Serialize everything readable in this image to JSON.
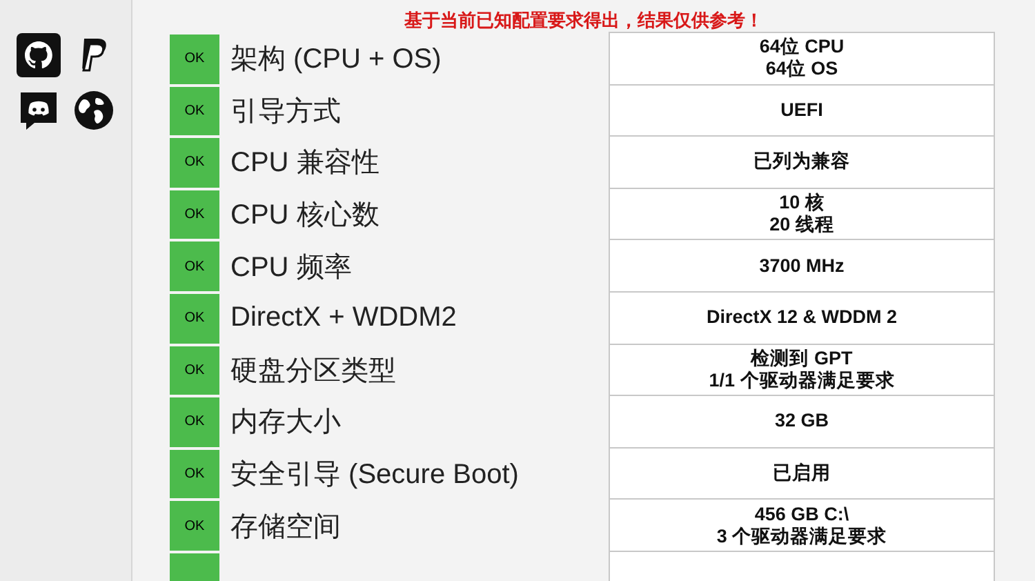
{
  "notice": "基于当前已知配置要求得出，结果仅供参考！",
  "sidebar": {
    "links": [
      {
        "kind": "github"
      },
      {
        "kind": "paypal"
      },
      {
        "kind": "discord"
      },
      {
        "kind": "globe"
      }
    ]
  },
  "checks": [
    {
      "status": "OK",
      "passed": true,
      "label": "架构 (CPU + OS)",
      "value": [
        "64位 CPU",
        "64位 OS"
      ]
    },
    {
      "status": "OK",
      "passed": true,
      "label": "引导方式",
      "value": [
        "UEFI"
      ]
    },
    {
      "status": "OK",
      "passed": true,
      "label": "CPU 兼容性",
      "value": [
        "已列为兼容"
      ]
    },
    {
      "status": "OK",
      "passed": true,
      "label": "CPU 核心数",
      "value": [
        "10 核",
        "20 线程"
      ]
    },
    {
      "status": "OK",
      "passed": true,
      "label": "CPU 频率",
      "value": [
        "3700 MHz"
      ]
    },
    {
      "status": "OK",
      "passed": true,
      "label": "DirectX + WDDM2",
      "value": [
        "DirectX 12 & WDDM 2"
      ]
    },
    {
      "status": "OK",
      "passed": true,
      "label": "硬盘分区类型",
      "value": [
        "检测到 GPT",
        "1/1 个驱动器满足要求"
      ]
    },
    {
      "status": "OK",
      "passed": true,
      "label": "内存大小",
      "value": [
        "32 GB"
      ]
    },
    {
      "status": "OK",
      "passed": true,
      "label": "安全引导 (Secure Boot)",
      "value": [
        "已启用"
      ]
    },
    {
      "status": "OK",
      "passed": true,
      "label": "存储空间",
      "value": [
        "456 GB C:\\",
        "3 个驱动器满足要求"
      ]
    },
    {
      "passed": true
    }
  ]
}
